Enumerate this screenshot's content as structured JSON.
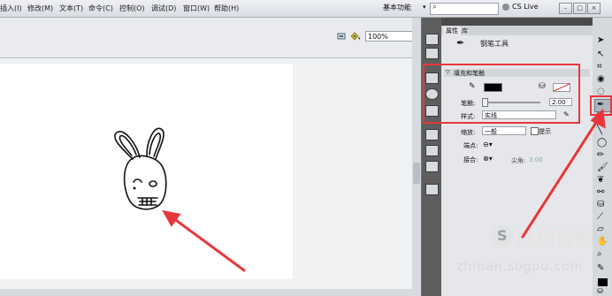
{
  "menubar": {
    "items": [
      {
        "label": "插入(I)"
      },
      {
        "label": "修改(M)"
      },
      {
        "label": "文本(T)"
      },
      {
        "label": "命令(C)"
      },
      {
        "label": "控制(O)"
      },
      {
        "label": "调试(D)"
      },
      {
        "label": "窗口(W)"
      },
      {
        "label": "帮助(H)"
      }
    ],
    "workspace": "基本功能",
    "cslive": "CS Live",
    "window_buttons": [
      "–",
      "□",
      "×"
    ]
  },
  "doc_toolbar": {
    "zoom": "100%"
  },
  "panel": {
    "tabs": [
      {
        "label": "属性"
      },
      {
        "label": "库"
      }
    ],
    "tool_name": "钢笔工具",
    "section_fill_stroke": "填充和笔触",
    "stroke_label": "笔触:",
    "stroke_value": "2.00",
    "style_label": "样式:",
    "style_value": "实线",
    "scale_label": "缩放:",
    "scale_value": "一般",
    "hint_label": "提示",
    "cap_label": "端点:",
    "join_label": "接合:",
    "miter_label": "尖角:",
    "miter_value": "3.00",
    "stroke_color": "#000000",
    "fill_color": "none"
  },
  "watermark": {
    "text": "搜狗指南",
    "url": "zhinan.sogou.com"
  },
  "colors": {
    "accent_red": "#e8363a",
    "stage": "#ffffff",
    "pasteboard": "#f0f1f2",
    "dark_ui": "#5e5e5e"
  }
}
